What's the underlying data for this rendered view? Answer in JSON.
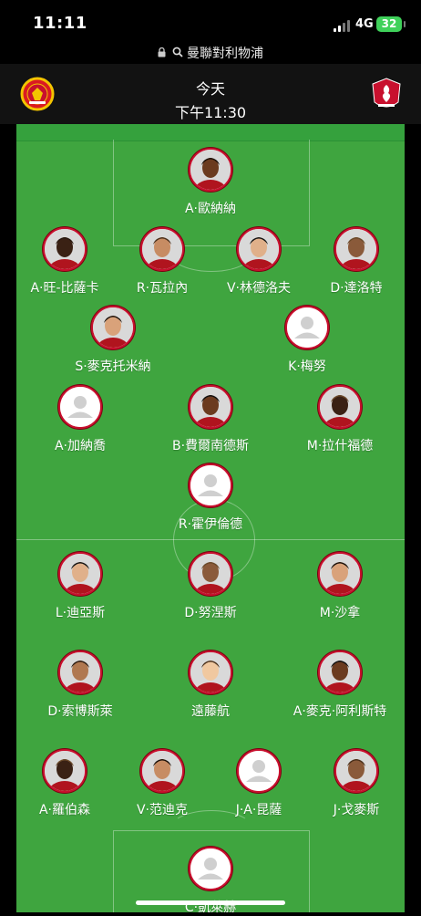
{
  "status_bar": {
    "time": "11:11",
    "network": "4G",
    "battery": "32"
  },
  "browser": {
    "url": "曼聯對利物浦"
  },
  "match": {
    "day": "今天",
    "time": "下午11:30",
    "home_team": "Manchester United",
    "away_team": "Liverpool",
    "colors": {
      "pitch": "#3fa53f",
      "header_bg": "#121212",
      "accent": "#c8102e"
    }
  },
  "lineup": {
    "home": [
      {
        "name": "A·歐納納",
        "photo": "photo"
      },
      {
        "name": "A·旺-比薩卡",
        "photo": "photo"
      },
      {
        "name": "R·瓦拉內",
        "photo": "photo"
      },
      {
        "name": "V·林德洛夫",
        "photo": "photo"
      },
      {
        "name": "D·達洛特",
        "photo": "photo"
      },
      {
        "name": "S·麥克托米納",
        "photo": "photo"
      },
      {
        "name": "K·梅努",
        "photo": "placeholder"
      },
      {
        "name": "A·加納喬",
        "photo": "placeholder"
      },
      {
        "name": "B·費爾南德斯",
        "photo": "photo"
      },
      {
        "name": "M·拉什福德",
        "photo": "photo"
      },
      {
        "name": "R·霍伊倫德",
        "photo": "placeholder"
      }
    ],
    "away": [
      {
        "name": "L·迪亞斯",
        "photo": "photo"
      },
      {
        "name": "D·努涅斯",
        "photo": "photo"
      },
      {
        "name": "M·沙拿",
        "photo": "photo"
      },
      {
        "name": "D·索博斯萊",
        "photo": "photo"
      },
      {
        "name": "遠藤航",
        "photo": "photo"
      },
      {
        "name": "A·麥克·阿利斯特",
        "photo": "photo"
      },
      {
        "name": "A·羅伯森",
        "photo": "photo"
      },
      {
        "name": "V·范迪克",
        "photo": "photo"
      },
      {
        "name": "J·A·昆薩",
        "photo": "placeholder"
      },
      {
        "name": "J·戈麥斯",
        "photo": "photo"
      },
      {
        "name": "C·凱萊赫",
        "photo": "placeholder"
      }
    ]
  }
}
